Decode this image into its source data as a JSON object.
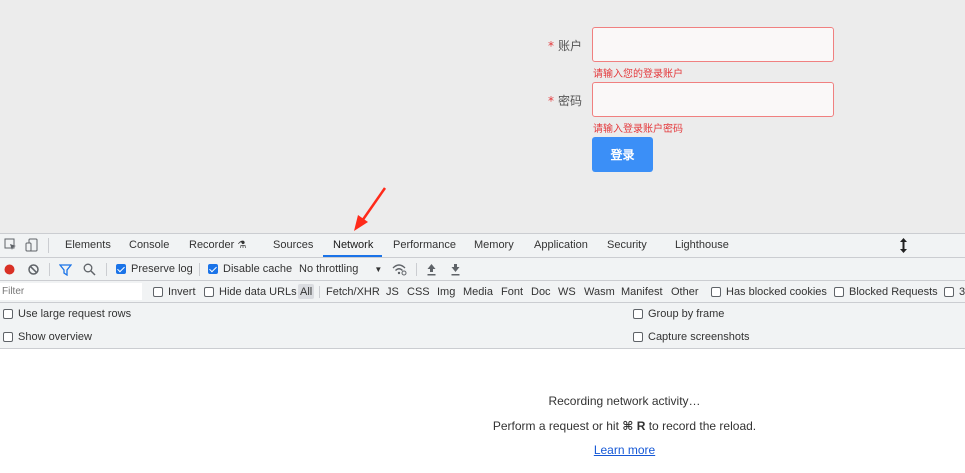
{
  "login_form": {
    "account_label": "账户",
    "account_error": "请输入您的登录账户",
    "password_label": "密码",
    "password_error": "请输入登录账户密码",
    "required_mark": "*",
    "submit_label": "登录"
  },
  "devtools": {
    "tabs": [
      "Elements",
      "Console",
      "Recorder",
      "Sources",
      "Network",
      "Performance",
      "Memory",
      "Application",
      "Security",
      "Lighthouse"
    ],
    "active_tab": "Network",
    "toolbar": {
      "preserve_log": "Preserve log",
      "preserve_log_checked": true,
      "disable_cache": "Disable cache",
      "disable_cache_checked": true,
      "throttling": "No throttling"
    },
    "filter_bar": {
      "filter_placeholder": "Filter",
      "invert": "Invert",
      "hide_data_urls": "Hide data URLs",
      "types": [
        "All",
        "Fetch/XHR",
        "JS",
        "CSS",
        "Img",
        "Media",
        "Font",
        "Doc",
        "WS",
        "Wasm",
        "Manifest",
        "Other"
      ],
      "has_blocked_cookies": "Has blocked cookies",
      "blocked_requests": "Blocked Requests",
      "truncated": "3"
    },
    "settings": {
      "large_rows": "Use large request rows",
      "show_overview": "Show overview",
      "group_by_frame": "Group by frame",
      "capture_screenshots": "Capture screenshots"
    },
    "empty_state": {
      "line1": "Recording network activity…",
      "line2_prefix": "Perform a request or hit ",
      "line2_keys": "⌘ R",
      "line2_suffix": " to record the reload.",
      "learn_more": "Learn more"
    }
  },
  "colors": {
    "error_red": "#e4393c",
    "primary_blue": "#3b8ff7",
    "devtools_accent": "#1a73e8",
    "annotation_arrow": "#ff2a1a"
  }
}
